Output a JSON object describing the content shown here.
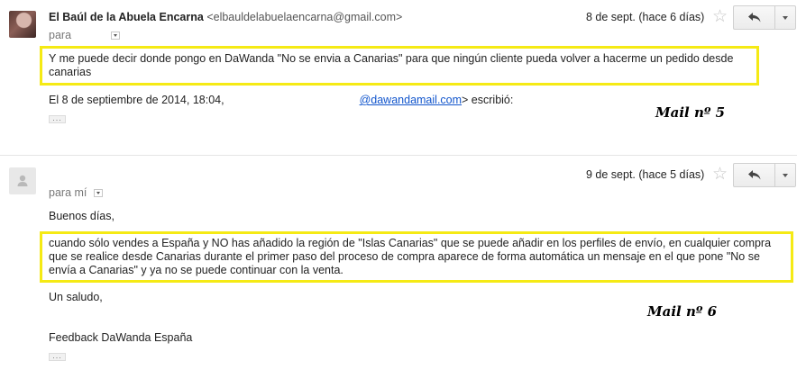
{
  "mail5": {
    "sender_name": "El Baúl de la Abuela Encarna",
    "sender_email": "<elbauldelabuelaencarna@gmail.com>",
    "to_label": "para",
    "date": "8 de sept. (hace 6 días)",
    "body": "Y me puede decir donde pongo en DaWanda \"No se envia a Canarias\" para que ningún cliente pueda volver a hacerme un pedido desde canarias",
    "quote_prefix": "El 8 de septiembre de 2014, 18:04,",
    "quote_link": "@dawandamail.com",
    "quote_suffix": "> escribió:",
    "ellipsis": "...",
    "annotation": "Mail nº 5"
  },
  "mail6": {
    "to_label": "para mí",
    "date": "9 de sept. (hace 5 días)",
    "greeting": "Buenos días,",
    "body": "cuando sólo vendes a España y NO has añadido la región de \"Islas Canarias\" que se puede añadir en los perfiles de envío, en cualquier compra que se realice desde Canarias durante el primer paso del proceso de compra aparece de forma automática un mensaje en el que pone \"No se envía a Canarias\"  y ya no se puede continuar con la venta.",
    "closing": "Un saludo,",
    "signature": "Feedback DaWanda España",
    "ellipsis": "...",
    "annotation": "Mail nº 6"
  },
  "icons": {
    "star": "star-icon",
    "reply": "reply-arrow-icon",
    "more": "caret-down-icon",
    "person": "person-silhouette-icon"
  },
  "colors": {
    "highlight": "#f5ea14",
    "link": "#1155cc"
  }
}
